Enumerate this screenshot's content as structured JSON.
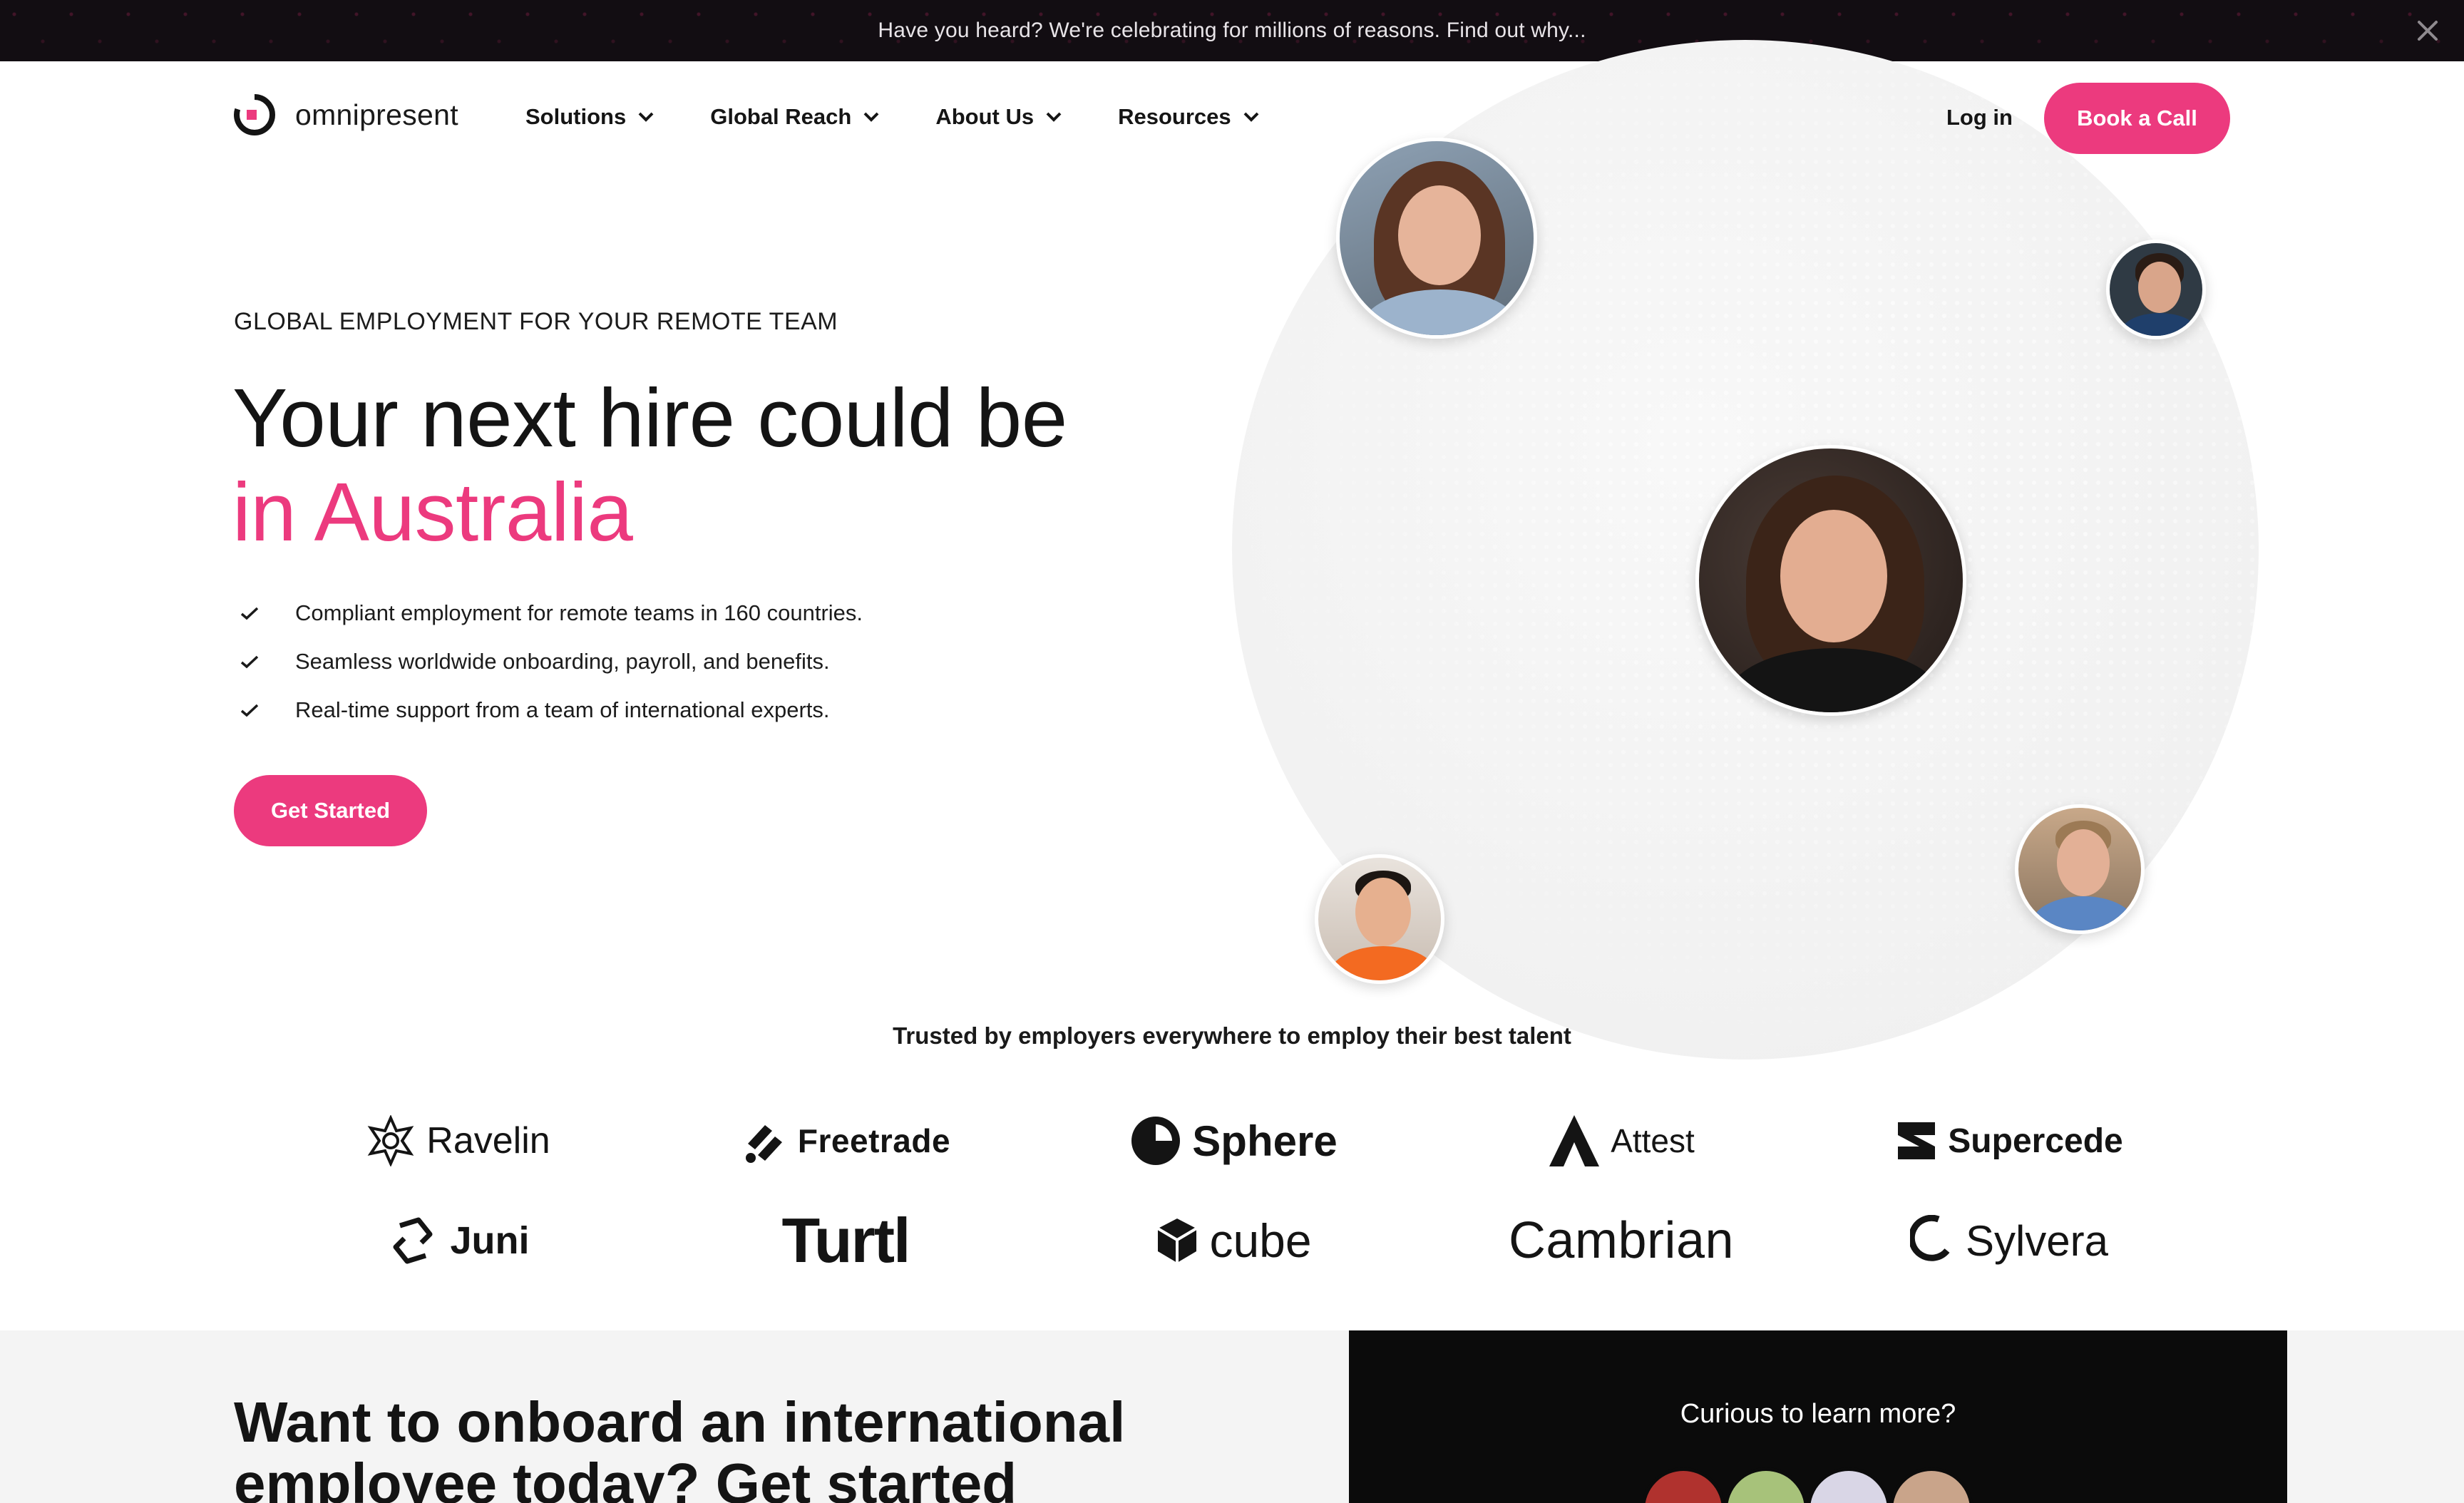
{
  "announcement": {
    "text": "Have you heard? We're celebrating for millions of reasons. Find out why...",
    "close_icon": "close-icon"
  },
  "header": {
    "logo_text": "omnipresent",
    "nav": [
      {
        "label": "Solutions"
      },
      {
        "label": "Global Reach"
      },
      {
        "label": "About Us"
      },
      {
        "label": "Resources"
      }
    ],
    "login_label": "Log in",
    "cta_label": "Book a Call"
  },
  "hero": {
    "eyebrow": "GLOBAL EMPLOYMENT FOR YOUR REMOTE TEAM",
    "headline_part1": "Your next hire could be ",
    "headline_accent": "in Australia",
    "bullets": [
      "Compliant employment for remote teams in 160 countries.",
      "Seamless worldwide onboarding, payroll, and benefits.",
      "Real-time support from a team of international experts."
    ],
    "cta_label": "Get Started"
  },
  "trusted": {
    "heading": "Trusted by employers everywhere to employ their best talent",
    "logos": [
      "Ravelin",
      "Freetrade",
      "Sphere",
      "Attest",
      "Supercede",
      "Juni",
      "Turtl",
      "cube",
      "Cambrian",
      "Sylvera"
    ]
  },
  "bottom": {
    "title": "Want to onboard an international employee today? Get started",
    "card_title": "Curious to learn more?"
  },
  "colors": {
    "accent": "#ec3a7e",
    "announcement_bg": "#120d12",
    "dark_card": "#0b0b0b"
  }
}
